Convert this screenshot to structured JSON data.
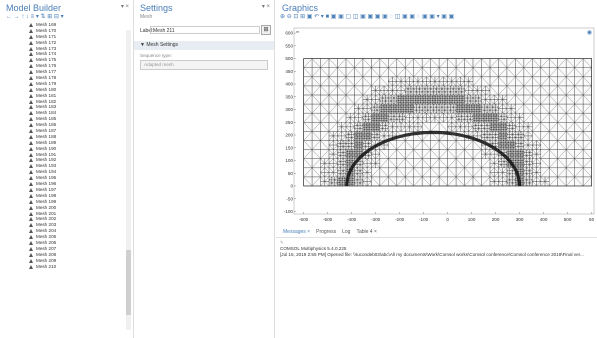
{
  "model_builder": {
    "title": "Model Builder",
    "toolbar": "← → ↑ ↓ ≡ ▾ ⇅ ⊞ ⊟ ▾",
    "pin": "▾ ×",
    "items": [
      "Mesh 169",
      "Mesh 170",
      "Mesh 171",
      "Mesh 172",
      "Mesh 173",
      "Mesh 174",
      "Mesh 175",
      "Mesh 176",
      "Mesh 177",
      "Mesh 178",
      "Mesh 179",
      "Mesh 180",
      "Mesh 181",
      "Mesh 182",
      "Mesh 183",
      "Mesh 184",
      "Mesh 185",
      "Mesh 186",
      "Mesh 187",
      "Mesh 188",
      "Mesh 189",
      "Mesh 190",
      "Mesh 191",
      "Mesh 192",
      "Mesh 193",
      "Mesh 194",
      "Mesh 195",
      "Mesh 196",
      "Mesh 197",
      "Mesh 198",
      "Mesh 199",
      "Mesh 200",
      "Mesh 201",
      "Mesh 202",
      "Mesh 203",
      "Mesh 204",
      "Mesh 205",
      "Mesh 206",
      "Mesh 207",
      "Mesh 208",
      "Mesh 209",
      "Mesh 210"
    ],
    "item_icon": "mesh-triangle-icon"
  },
  "settings": {
    "title": "Settings",
    "pin": "▾ ×",
    "subtitle": "Mesh",
    "label_text": "Label:",
    "label_value": "Mesh 211",
    "label_button": "⊞",
    "section": "▼ Mesh Settings",
    "sequence_label": "Sequence type:",
    "sequence_value": "Adapted mesh"
  },
  "graphics": {
    "title": "Graphics",
    "toolbar": "⊕ ⊖ ⊡ ⊞ ▣ ↶ ▾ ■ ▣ ▣ ▢ ◫ ▣ ▣ ▣ ▣ ◌ ◫ ▣ ▣ ◌ ▣ ▣ ▾ ▣ ▣",
    "y_ticks": [
      "600",
      "550",
      "500",
      "450",
      "400",
      "350",
      "300",
      "250",
      "200",
      "150",
      "100",
      "50",
      "0",
      "-50",
      "-100"
    ],
    "x_ticks": [
      "-600",
      "-500",
      "-400",
      "-300",
      "-200",
      "-100",
      "0",
      "100",
      "200",
      "300",
      "400",
      "500",
      "60"
    ],
    "corner_label": "m",
    "y_unit": "μm",
    "x_unit": "μm"
  },
  "messages": {
    "tabs": [
      "Messages ×",
      "Progress",
      "Log",
      "Table 4 ×"
    ],
    "active_tab": 0,
    "lines": [
      "COMSOL Multiphysics 5.4.0.225",
      "[Jul 15, 2019 2:55 PM] Opened file: \\\\Iucondeb03\\abc\\All my documents\\Work\\Comsol works\\Comsol conference\\Comsol conference 2019\\Final ver..."
    ]
  },
  "colors": {
    "accent": "#4a7fb8",
    "mesh": "#222222"
  }
}
